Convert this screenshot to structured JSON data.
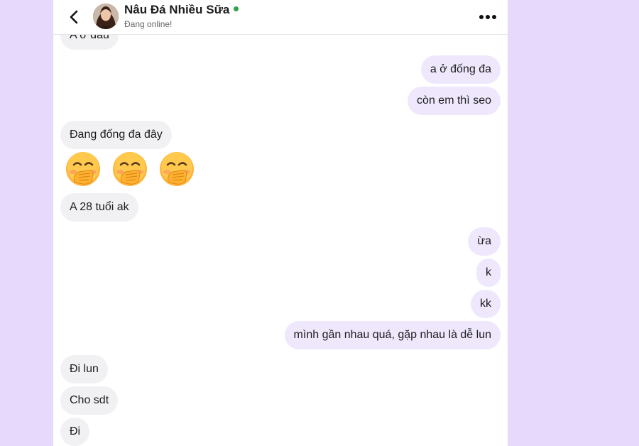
{
  "contact": {
    "name": "Nâu Đá Nhiều Sữa",
    "status": "Đang online!"
  },
  "messages": [
    {
      "from": "them",
      "text": "A ở đâu"
    },
    {
      "from": "me",
      "text": "a ở đống đa"
    },
    {
      "from": "me",
      "text": "còn em thì seo"
    },
    {
      "from": "them",
      "text": "Đang đống đa đây"
    },
    {
      "from": "them",
      "emoji": [
        "face-with-hand-over-mouth",
        "face-with-hand-over-mouth",
        "face-with-hand-over-mouth"
      ]
    },
    {
      "from": "them",
      "text": "A 28 tuổi ak"
    },
    {
      "from": "me",
      "text": "ừa"
    },
    {
      "from": "me",
      "text": "k"
    },
    {
      "from": "me",
      "text": "kk"
    },
    {
      "from": "me",
      "text": "mình gần nhau quá, gặp nhau là dễ lun"
    },
    {
      "from": "them",
      "text": "Đi lun"
    },
    {
      "from": "them",
      "text": "Cho sdt"
    },
    {
      "from": "them",
      "text": "Đi"
    }
  ],
  "colors": {
    "background": "#e7d9fb",
    "incoming_bubble": "#f1f1f3",
    "outgoing_bubble": "#efe8fd",
    "online": "#31a24c"
  },
  "icons": {
    "back": "chevron-left-icon",
    "more": "more-horizontal-icon"
  }
}
